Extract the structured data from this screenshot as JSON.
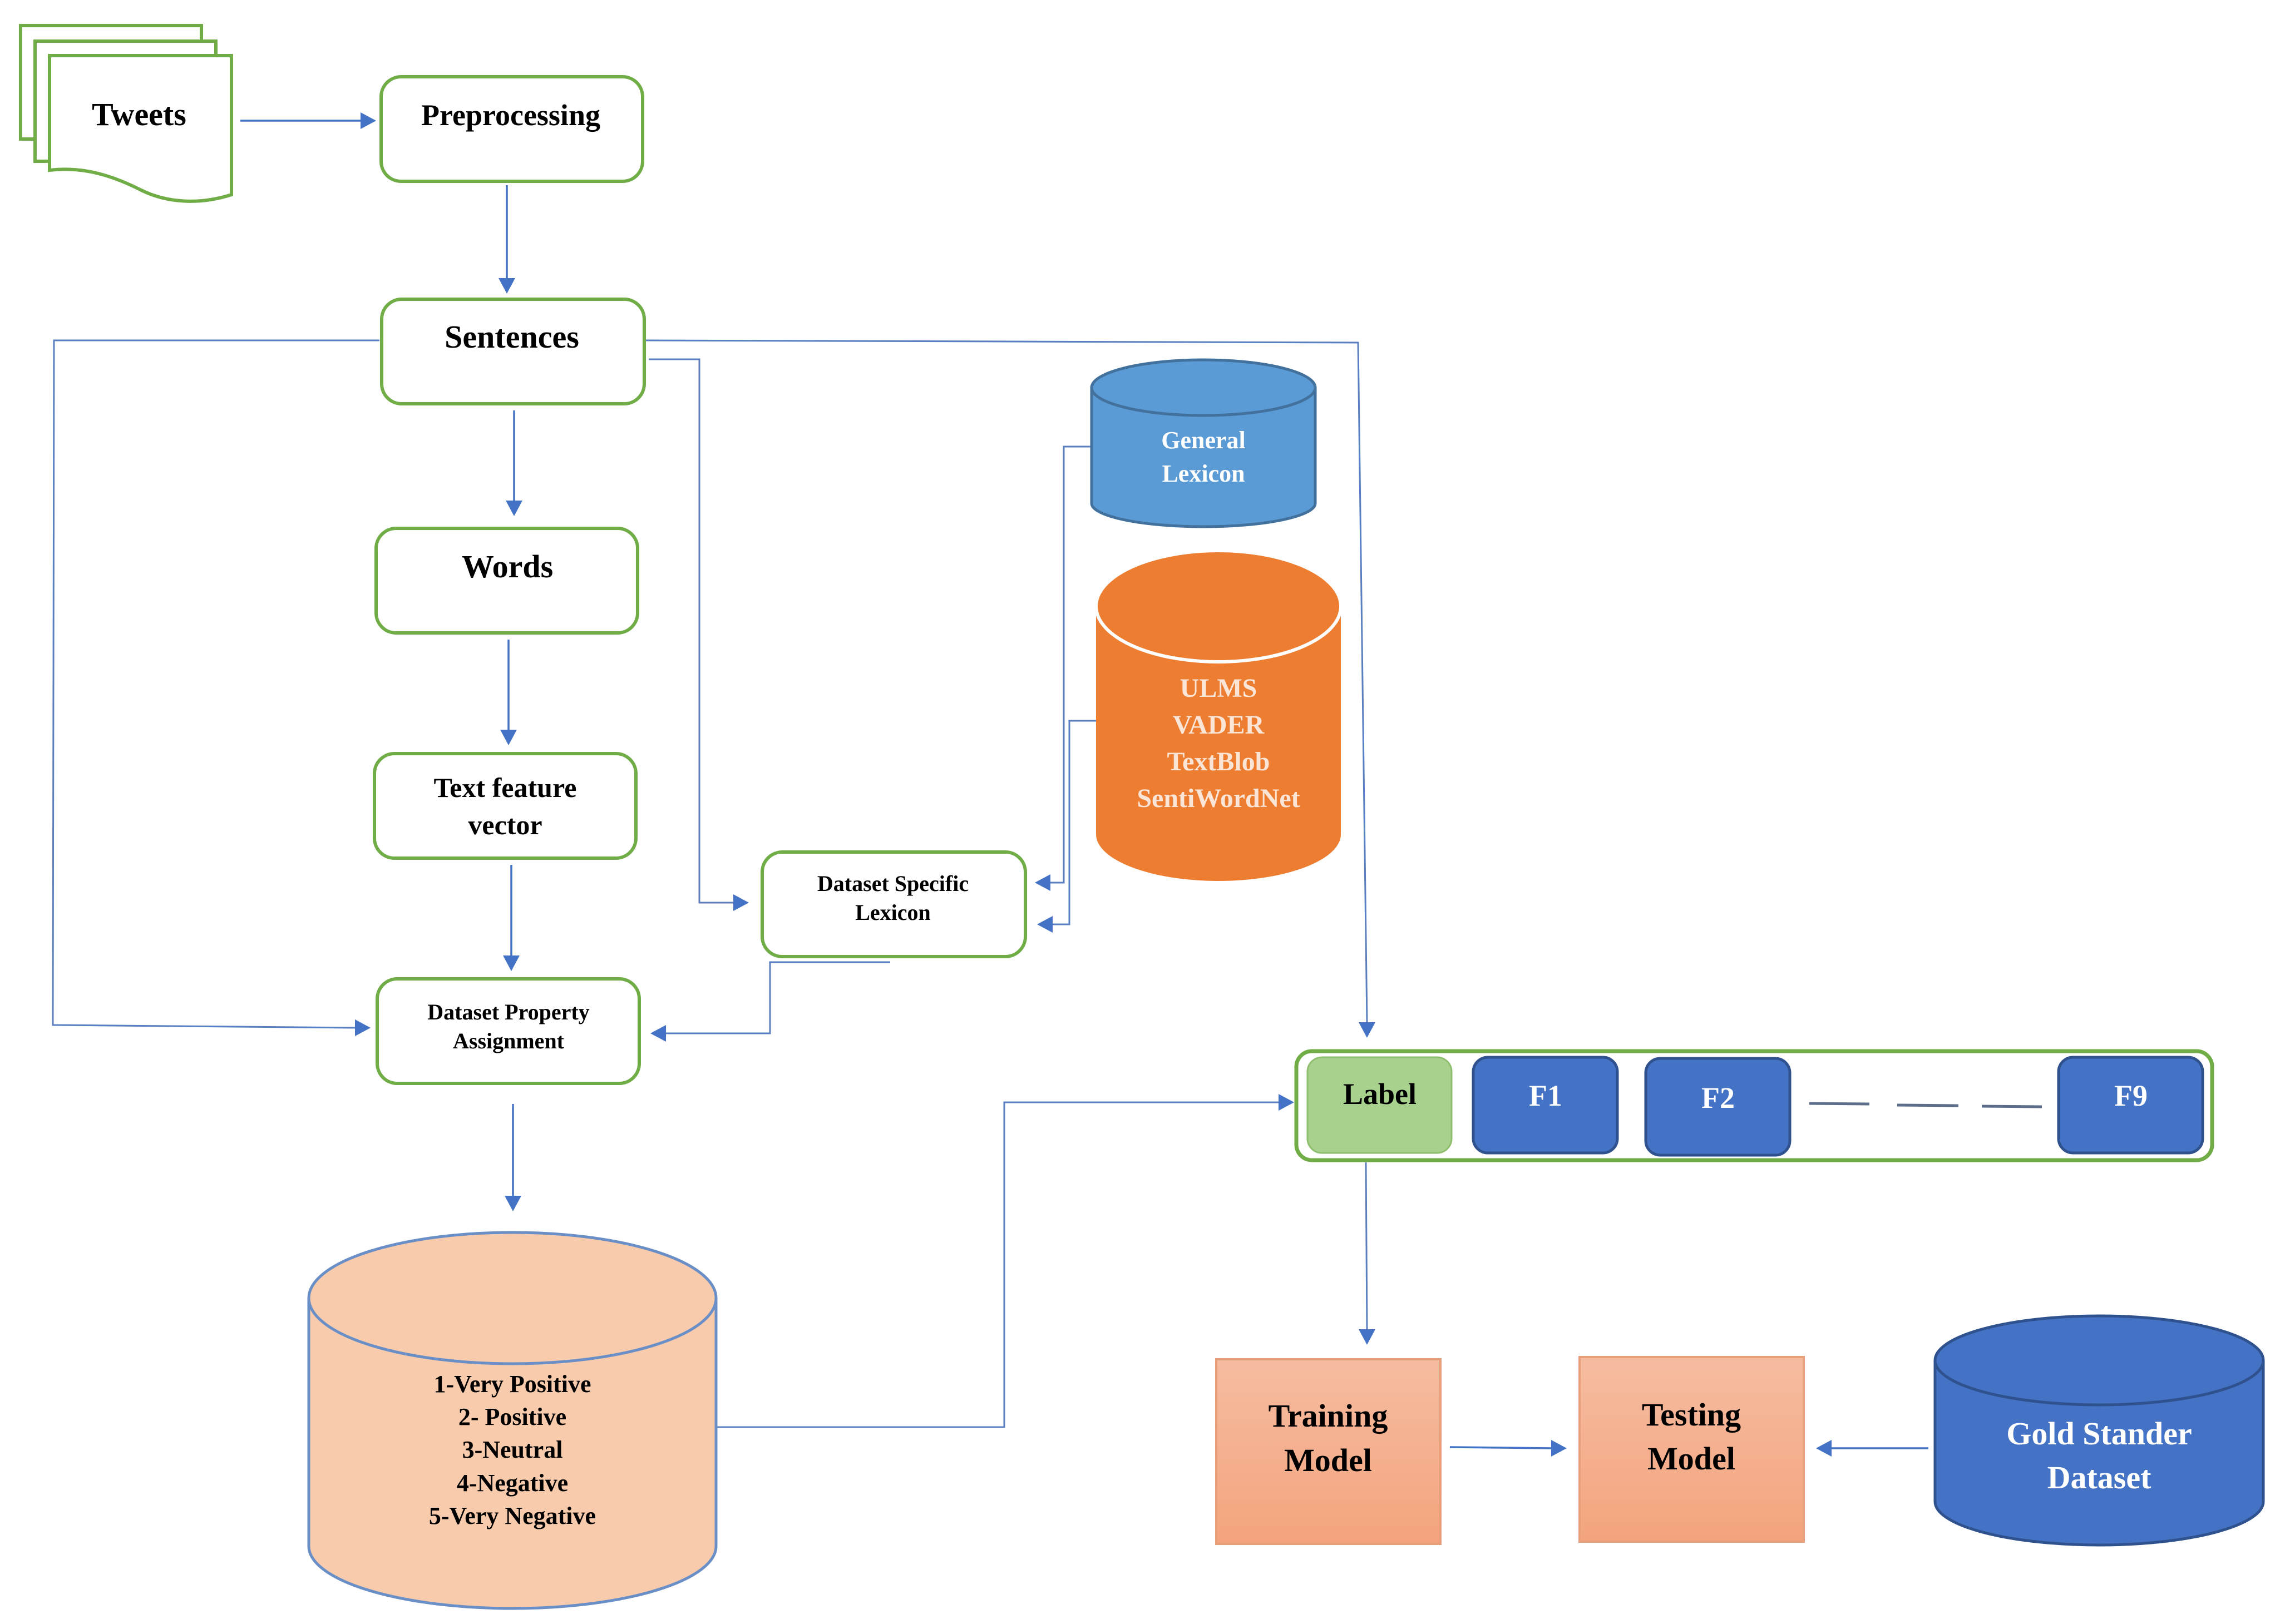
{
  "diagram": {
    "nodes": {
      "tweets": {
        "label": "Tweets",
        "shape": "multi-document"
      },
      "preprocessing": {
        "label": "Preprocessing"
      },
      "sentences": {
        "label": "Sentences"
      },
      "words": {
        "label": "Words"
      },
      "text_feature_vector": {
        "lines": [
          "Text feature",
          "vector"
        ]
      },
      "dataset_property_assignment": {
        "lines": [
          "Dataset Property",
          "Assignment"
        ]
      },
      "dataset_specific_lexicon": {
        "lines": [
          "Dataset Specific",
          "Lexicon"
        ]
      },
      "general_lexicon": {
        "lines": [
          "General",
          "Lexicon"
        ],
        "shape": "cylinder"
      },
      "lexicon_tools": {
        "lines": [
          "ULMS",
          "VADER",
          "TextBlob",
          "SentiWordNet"
        ],
        "shape": "cylinder"
      },
      "sentiment_classes": {
        "lines": [
          "1-Very Positive",
          "2- Positive",
          "3-Neutral",
          "4-Negative",
          "5-Very Negative"
        ],
        "shape": "cylinder"
      },
      "feature_vector": {
        "label": "Label",
        "features": [
          "F1",
          "F2",
          "F9"
        ],
        "ellipsis": "— — —"
      },
      "training_model": {
        "lines": [
          "Training",
          "Model"
        ]
      },
      "testing_model": {
        "lines": [
          "Testing",
          "Model"
        ]
      },
      "gold_standard_dataset": {
        "lines": [
          "Gold Stander",
          "Dataset"
        ],
        "shape": "cylinder"
      }
    },
    "edges": [
      {
        "from": "tweets",
        "to": "preprocessing"
      },
      {
        "from": "preprocessing",
        "to": "sentences"
      },
      {
        "from": "sentences",
        "to": "words"
      },
      {
        "from": "words",
        "to": "text_feature_vector"
      },
      {
        "from": "text_feature_vector",
        "to": "dataset_property_assignment"
      },
      {
        "from": "sentences",
        "to": "dataset_property_assignment"
      },
      {
        "from": "sentences",
        "to": "dataset_specific_lexicon"
      },
      {
        "from": "sentences",
        "to": "feature_vector"
      },
      {
        "from": "general_lexicon",
        "to": "dataset_specific_lexicon"
      },
      {
        "from": "lexicon_tools",
        "to": "dataset_specific_lexicon"
      },
      {
        "from": "dataset_specific_lexicon",
        "to": "dataset_property_assignment"
      },
      {
        "from": "dataset_property_assignment",
        "to": "sentiment_classes"
      },
      {
        "from": "sentiment_classes",
        "to": "feature_vector"
      },
      {
        "from": "feature_vector",
        "to": "training_model"
      },
      {
        "from": "training_model",
        "to": "testing_model"
      },
      {
        "from": "gold_standard_dataset",
        "to": "testing_model"
      }
    ],
    "colors": {
      "box_border": "#70AD47",
      "connector": "#4472C4",
      "general_lexicon": "#5B9BD5",
      "lexicon_tools": "#ED7D31",
      "sentiment_classes": "#F8CBAD",
      "label_cell": "#A9D18E",
      "feature_cell": "#4472C4",
      "model_box": "#F4B183",
      "gold_standard": "#4472C4"
    }
  }
}
